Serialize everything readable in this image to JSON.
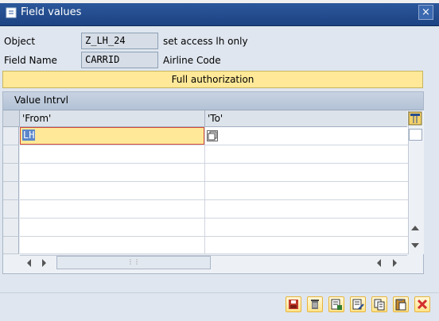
{
  "window": {
    "title": "Field values",
    "close_label": "×"
  },
  "form": {
    "object_label": "Object",
    "object_value": "Z_LH_24",
    "object_desc": "set access lh only",
    "fieldname_label": "Field Name",
    "fieldname_value": "CARRID",
    "fieldname_desc": "Airline Code"
  },
  "full_auth_label": "Full authorization",
  "table": {
    "title": "Value Intrvl",
    "columns": [
      "'From'",
      "'To'"
    ],
    "rows": [
      {
        "from": "LH",
        "to": ""
      }
    ]
  },
  "toolbar": {
    "buttons": [
      {
        "name": "save-icon",
        "color": "#c0392b"
      },
      {
        "name": "delete-icon",
        "color": "#555555"
      },
      {
        "name": "insert-row-icon",
        "color": "#2e7d32"
      },
      {
        "name": "edit-row-icon",
        "color": "#2a4d8f"
      },
      {
        "name": "copy-icon",
        "color": "#2a4d8f"
      },
      {
        "name": "paste-icon",
        "color": "#2a4d8f"
      },
      {
        "name": "cancel-icon",
        "color": "#d32f2f"
      }
    ]
  }
}
